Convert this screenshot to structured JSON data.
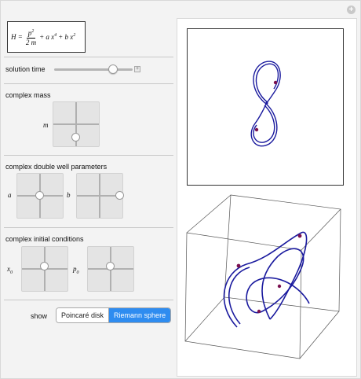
{
  "formula": {
    "H": "H =",
    "num": "p",
    "num_exp": "2",
    "den": "2 m",
    "t1": "+ a x",
    "t1_exp": "4",
    "t2": "+ b x",
    "t2_exp": "2"
  },
  "controls": {
    "solution_time": {
      "label": "solution time",
      "value": 0.75
    },
    "complex_mass": {
      "title": "complex mass",
      "m_label": "m",
      "m_re": 0.0,
      "m_im": -0.6
    },
    "double_well": {
      "title": "complex double well parameters",
      "a_label": "a",
      "a_re": 0.0,
      "a_im": 0.0,
      "b_label": "b",
      "b_re": 0.9,
      "b_im": 0.0
    },
    "initial": {
      "title": "complex initial conditions",
      "x0_label": "x",
      "x0_sub": "0",
      "x0_re": 0.0,
      "x0_im": 0.1,
      "p0_label": "p",
      "p0_sub": "0",
      "p0_re": 0.0,
      "p0_im": 0.1
    },
    "show": {
      "label": "show",
      "options": [
        "Poincaré disk",
        "Riemann sphere"
      ],
      "selected": "Riemann sphere"
    }
  },
  "colors": {
    "curve": "#1a1a9e",
    "point": "#7a1050",
    "active": "#2e8cf0"
  }
}
